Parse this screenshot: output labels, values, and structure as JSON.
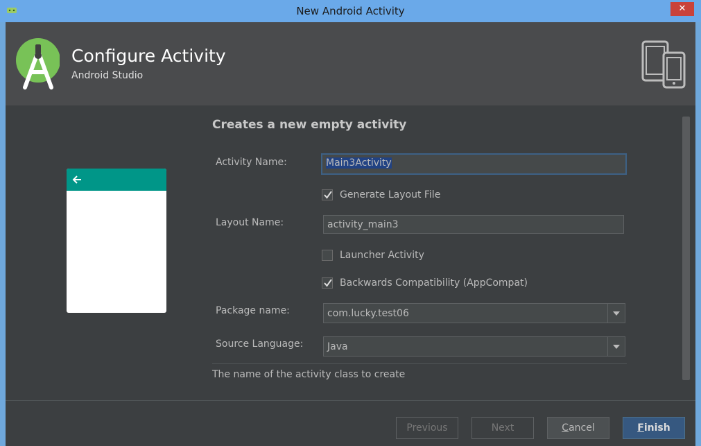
{
  "window": {
    "title": "New Android Activity",
    "close_glyph": "✕"
  },
  "header": {
    "title": "Configure Activity",
    "subtitle": "Android Studio",
    "logo_icon": "android-studio-logo-icon",
    "devices_icon": "tablet-phone-icon"
  },
  "form": {
    "heading": "Creates a new empty activity",
    "activity_name": {
      "label": "Activity Name:",
      "value": "Main3Activity"
    },
    "generate_layout": {
      "label": "Generate Layout File",
      "checked": true
    },
    "layout_name": {
      "label": "Layout Name:",
      "value": "activity_main3"
    },
    "launcher_activity": {
      "label": "Launcher Activity",
      "checked": false
    },
    "backwards_compat": {
      "label": "Backwards Compatibility (AppCompat)",
      "checked": true
    },
    "package_name": {
      "label": "Package name:",
      "value": "com.lucky.test06"
    },
    "source_language": {
      "label": "Source Language:",
      "value": "Java"
    },
    "hint": "The name of the activity class to create"
  },
  "buttons": {
    "previous": "Previous",
    "next": "Next",
    "cancel_first": "C",
    "cancel_rest": "ancel",
    "finish_first": "F",
    "finish_rest": "inish"
  },
  "colors": {
    "accent_bar": "#009688",
    "selection": "#214283",
    "primary_button": "#365880",
    "title_bar": "#6aa9e9"
  }
}
